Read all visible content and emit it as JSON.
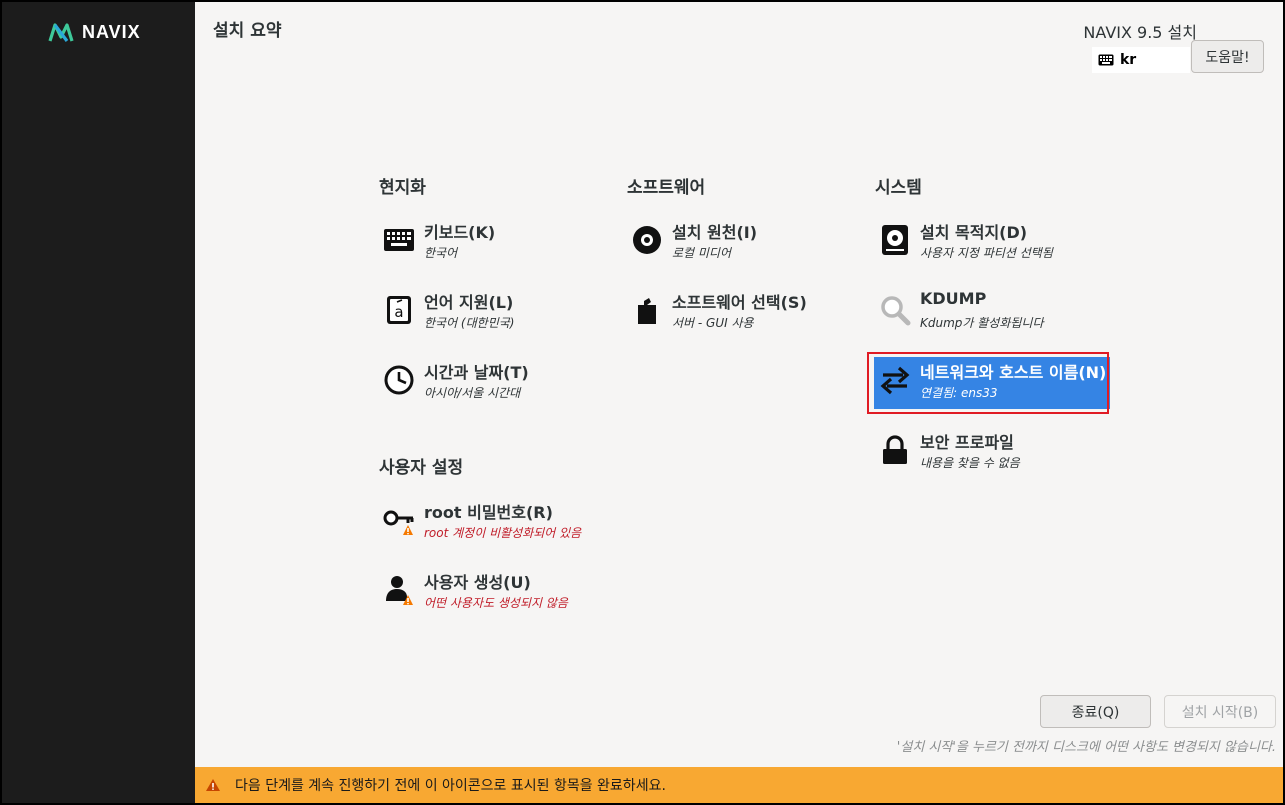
{
  "brand": {
    "logo_text": "NAVIX"
  },
  "header": {
    "page_title": "설치 요약",
    "product_title": "NAVIX 9.5 설치",
    "keyboard_layout": "kr",
    "help_label": "도움말!"
  },
  "sections": {
    "localization": "현지화",
    "software": "소프트웨어",
    "system": "시스템",
    "user_settings": "사용자 설정"
  },
  "spokes": {
    "keyboard": {
      "title": "키보드(K)",
      "status": "한국어",
      "icon": "keyboard-icon"
    },
    "language": {
      "title": "언어 지원(L)",
      "status": "한국어 (대한민국)",
      "icon": "language-icon"
    },
    "time": {
      "title": "시간과 날짜(T)",
      "status": "아시아/서울 시간대",
      "icon": "clock-icon"
    },
    "source": {
      "title": "설치 원천(I)",
      "status": "로컬 미디어",
      "icon": "disc-icon"
    },
    "software": {
      "title": "소프트웨어 선택(S)",
      "status": "서버 - GUI 사용",
      "icon": "package-icon"
    },
    "destination": {
      "title": "설치 목적지(D)",
      "status": "사용자 지정 파티션 선택됨",
      "icon": "harddisk-icon"
    },
    "kdump": {
      "title": "KDUMP",
      "status": "Kdump가 활성화됩니다",
      "icon": "magnifier-icon"
    },
    "network": {
      "title": "네트워크와 호스트 이름(N)",
      "status": "연결됨: ens33",
      "icon": "network-arrows-icon"
    },
    "security": {
      "title": "보안 프로파일",
      "status": "내용을 찾을 수 없음",
      "icon": "lock-icon"
    },
    "root": {
      "title": "root 비밀번호(R)",
      "status": "root 계정이 비활성화되어 있음",
      "icon": "key-icon"
    },
    "user": {
      "title": "사용자 생성(U)",
      "status": "어떤 사용자도 생성되지 않음",
      "icon": "user-icon"
    }
  },
  "footer": {
    "quit_label": "종료(Q)",
    "begin_label": "설치 시작(B)",
    "note": "'설치 시작'을 누르기 전까지 디스크에 어떤 사항도 변경되지 않습니다.",
    "warning": "다음 단계를 계속 진행하기 전에 이 아이콘으로 표시된 항목을 완료하세요."
  },
  "colors": {
    "sidebar": "#1c1c1c",
    "accent": "#3584e4",
    "warning_bar": "#f8a832",
    "warning_text": "#c01c28",
    "highlight_border": "#e01b24",
    "logo_green": "#3ec99a"
  }
}
